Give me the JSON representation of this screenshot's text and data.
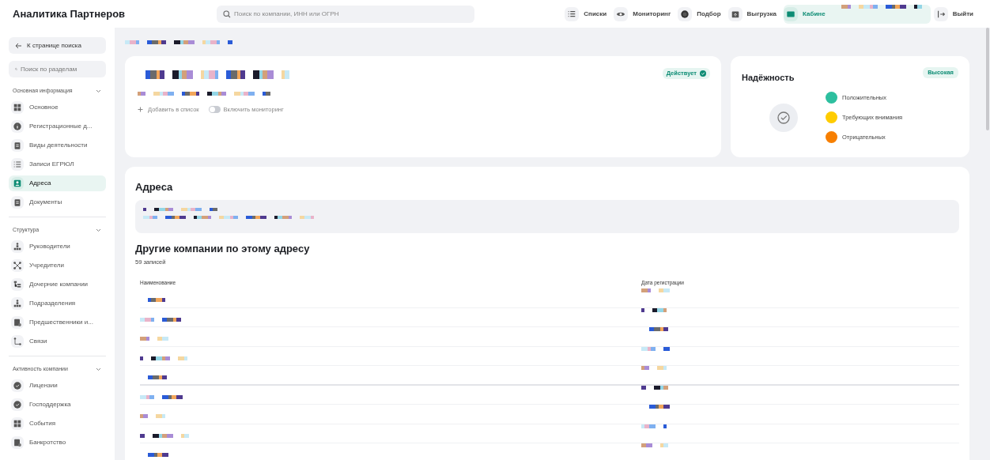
{
  "app_title": "Аналитика Партнеров",
  "search": {
    "placeholder": "Поиск по компании, ИНН или ОГРН"
  },
  "nav": [
    {
      "label": "Списки",
      "kind": "list",
      "selected": false
    },
    {
      "label": "Мониторинг",
      "kind": "eye",
      "selected": false
    },
    {
      "label": "Подбор",
      "kind": "dot",
      "selected": false
    },
    {
      "label": "Выгрузка",
      "kind": "box",
      "selected": false
    },
    {
      "label": "Кабине",
      "kind": "card",
      "selected": true
    },
    {
      "label": "Выйти",
      "kind": "exit",
      "selected": false
    }
  ],
  "sidebar": {
    "back": "К странице поиска",
    "search_placeholder": "Поиск по разделам",
    "sections": [
      {
        "title": "Основная информация",
        "expanded": true,
        "items": [
          {
            "label": "Основное",
            "kind": "grid",
            "selected": false
          },
          {
            "label": "Регистрационные д...",
            "kind": "info",
            "selected": false
          },
          {
            "label": "Виды деятельности",
            "kind": "clip",
            "selected": false
          },
          {
            "label": "Записи ЕГРЮЛ",
            "kind": "list",
            "selected": false
          },
          {
            "label": "Адреса",
            "kind": "person",
            "selected": true
          },
          {
            "label": "Документы",
            "kind": "clip",
            "selected": false
          }
        ]
      },
      {
        "title": "Структура",
        "expanded": true,
        "items": [
          {
            "label": "Руководители",
            "kind": "org",
            "selected": false
          },
          {
            "label": "Учредители",
            "kind": "net",
            "selected": false
          },
          {
            "label": "Дочерние компании",
            "kind": "tree",
            "selected": false
          },
          {
            "label": "Подразделения",
            "kind": "org",
            "selected": false
          },
          {
            "label": "Предшественники и...",
            "kind": "doc",
            "selected": false
          },
          {
            "label": "Связи",
            "kind": "link",
            "selected": false
          }
        ]
      },
      {
        "title": "Активность компании",
        "expanded": true,
        "items": [
          {
            "label": "Лицензии",
            "kind": "badge",
            "selected": false
          },
          {
            "label": "Господдержка",
            "kind": "badge",
            "selected": false
          },
          {
            "label": "События",
            "kind": "grid",
            "selected": false
          },
          {
            "label": "Банкротство",
            "kind": "doc",
            "selected": false
          }
        ]
      }
    ]
  },
  "company_card": {
    "status": "Действует",
    "add_to_list": "Добавить в список",
    "monitoring": {
      "label": "Включить мониторинг",
      "on": false
    }
  },
  "reliability": {
    "title": "Надёжность",
    "badge": "Высокая",
    "legend": [
      {
        "label": "Положительных",
        "color": "#2dbf9f"
      },
      {
        "label": "Требующих внимания",
        "color": "#ffcc00"
      },
      {
        "label": "Отрицательных",
        "color": "#f77f00"
      }
    ]
  },
  "addresses": {
    "title": "Адреса",
    "other_title": "Другие компании по этому адресу",
    "count": "59 записей",
    "columns": [
      "Наименование",
      "Дата регистрации"
    ]
  }
}
